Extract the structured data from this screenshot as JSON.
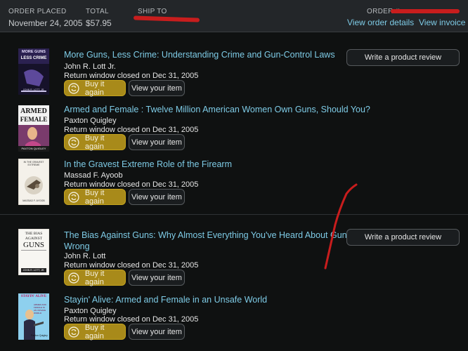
{
  "header": {
    "order_placed_label": "ORDER PLACED",
    "order_placed_value": "November 24, 2005",
    "total_label": "TOTAL",
    "total_value": "$57.95",
    "ship_to_label": "SHIP TO",
    "order_label": "ORDER #",
    "view_details_link": "View order details",
    "view_invoice_link": "View invoice"
  },
  "buttons": {
    "buy_again": "Buy it again",
    "view_item": "View your item",
    "write_review": "Write a product review"
  },
  "items": [
    {
      "title": "More Guns, Less Crime: Understanding Crime and Gun-Control Laws",
      "author": "John R. Lott Jr.",
      "return": "Return window closed on Dec 31, 2005",
      "cover_text_top": "MORE GUNS",
      "cover_text_bottom": "LESS CRIME",
      "cover_author": "JOHN R. LOTT, JR."
    },
    {
      "title": "Armed and Female : Twelve Million American Women Own Guns, Should You?",
      "author": "Paxton Quigley",
      "return": "Return window closed on Dec 31, 2005",
      "cover_text_top": "ARMED",
      "cover_text_bottom": "FEMALE",
      "cover_author": "PAXTON QUIGLEY"
    },
    {
      "title": "In the Gravest Extreme Role of the Firearm",
      "author": "Massad F. Ayoob",
      "return": "Return window closed on Dec 31, 2005",
      "cover_text_top": "IN THE GRAVEST EXTREME",
      "cover_text_bottom": "",
      "cover_author": "MASSAD F. AYOOB"
    },
    {
      "title_line1": "The Bias Against Guns: Why Almost Everything You've Heard About Gun Control Is",
      "title_line2": "Wrong",
      "author": "John R. Lott",
      "return": "Return window closed on Dec 31, 2005",
      "cover_text_top": "THE BIAS",
      "cover_text_mid": "AGAINST",
      "cover_text_bottom": "GUNS",
      "cover_author": "JOHN R. LOTT, JR."
    },
    {
      "title": "Stayin' Alive: Armed and Female in an Unsafe World",
      "author": "Paxton Quigley",
      "return": "Return window closed on Dec 31, 2005",
      "cover_text_top": "STAYIN' ALIVE",
      "cover_text_bottom": "ARMED AND FEMALE IN AN UNSAFE WORLD",
      "cover_author": "Paxton Quigley"
    }
  ],
  "colors": {
    "background": "#0f1111",
    "header_bg": "#232629",
    "link": "#7ecbe6",
    "buy_button": "#a88a1a",
    "redaction": "#c81d1d"
  },
  "icons": {
    "buy_again": "reorder-cycle-icon"
  }
}
